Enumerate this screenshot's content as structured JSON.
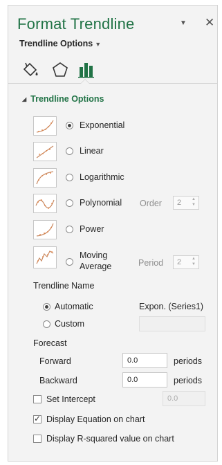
{
  "pane": {
    "title": "Format Trendline",
    "dropdown_glyph": "▼",
    "close_glyph": "✕",
    "section_dropdown": "Trendline Options",
    "section_caret": "▼"
  },
  "tabs": {
    "fill_line_icon": "paint-bucket",
    "effects_icon": "pentagon",
    "options_icon": "bar-chart",
    "accent": "#217346"
  },
  "group": {
    "title": "Trendline Options",
    "collapse_glyph": "◢"
  },
  "types": [
    {
      "label": "Exponential",
      "selected": true
    },
    {
      "label": "Linear",
      "selected": false
    },
    {
      "label": "Logarithmic",
      "selected": false
    },
    {
      "label": "Polynomial",
      "selected": false
    },
    {
      "label": "Power",
      "selected": false
    },
    {
      "label": "Moving",
      "label2": "Average",
      "selected": false
    }
  ],
  "polynomial_order": {
    "label": "Order",
    "value": "2"
  },
  "moving_period": {
    "label": "Period",
    "value": "2"
  },
  "name": {
    "heading": "Trendline Name",
    "automatic_label": "Automatic",
    "automatic_value": "Expon. (Series1)",
    "custom_label": "Custom",
    "custom_value": ""
  },
  "forecast": {
    "heading": "Forecast",
    "forward_label": "Forward",
    "forward_value": "0.0",
    "backward_label": "Backward",
    "backward_value": "0.0",
    "unit": "periods"
  },
  "intercept": {
    "label": "Set Intercept",
    "checked": false,
    "value": "0.0"
  },
  "display_equation": {
    "label": "Display Equation on chart",
    "checked": true
  },
  "display_r2": {
    "label": "Display R-squared value on chart",
    "checked": false
  }
}
